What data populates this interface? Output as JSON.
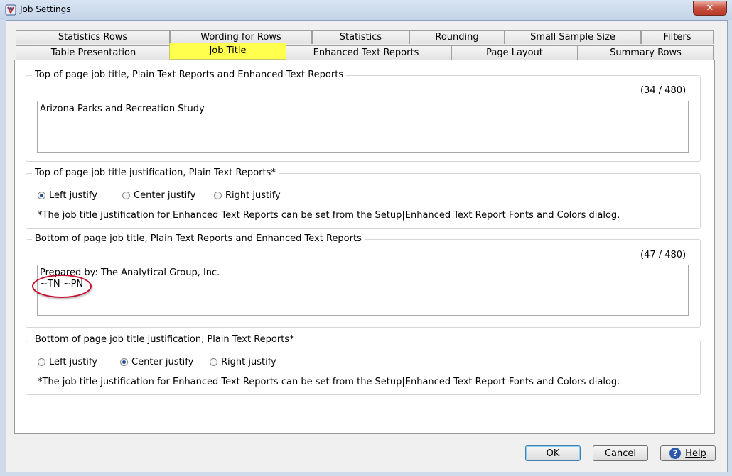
{
  "window": {
    "title": "Job Settings",
    "app_icon": "app-icon",
    "close_symbol": "✕"
  },
  "tabs": {
    "row1": [
      {
        "label": "Statistics Rows"
      },
      {
        "label": "Wording for Rows"
      },
      {
        "label": "Statistics"
      },
      {
        "label": "Rounding"
      },
      {
        "label": "Small Sample Size"
      },
      {
        "label": "Filters"
      }
    ],
    "row2": [
      {
        "label": "Table Presentation"
      },
      {
        "label": "Job Title",
        "active": true
      },
      {
        "label": "Enhanced Text Reports"
      },
      {
        "label": "Page Layout"
      },
      {
        "label": "Summary Rows"
      }
    ]
  },
  "top_title": {
    "label": "Top of page job title, Plain Text Reports and Enhanced Text Reports",
    "counter": "(34 / 480)",
    "value": "Arizona Parks and Recreation Study"
  },
  "top_justify": {
    "label": "Top of page job title justification, Plain Text Reports*",
    "options": [
      "Left justify",
      "Center justify",
      "Right justify"
    ],
    "selected": "Left justify",
    "note": "*The job title justification for Enhanced Text Reports can be set from the Setup|Enhanced Text Report Fonts and Colors dialog."
  },
  "bottom_title": {
    "label": "Bottom of page job title, Plain Text Reports and Enhanced Text Reports",
    "counter": "(47 / 480)",
    "value": "Prepared by: The Analytical Group, Inc.\n~TN ~PN"
  },
  "bottom_justify": {
    "label": "Bottom of page job title justification, Plain Text Reports*",
    "options": [
      "Left justify",
      "Center justify",
      "Right justify"
    ],
    "selected": "Center justify",
    "note": "*The job title justification for Enhanced Text Reports can be set from the Setup|Enhanced Text Report Fonts and Colors dialog."
  },
  "buttons": {
    "ok": "OK",
    "cancel": "Cancel",
    "help": "Help",
    "help_icon_glyph": "?"
  },
  "colors": {
    "active_tab_highlight": "#ffff4d",
    "annotation_circle": "#c8102e",
    "close_button": "#c7503e"
  }
}
